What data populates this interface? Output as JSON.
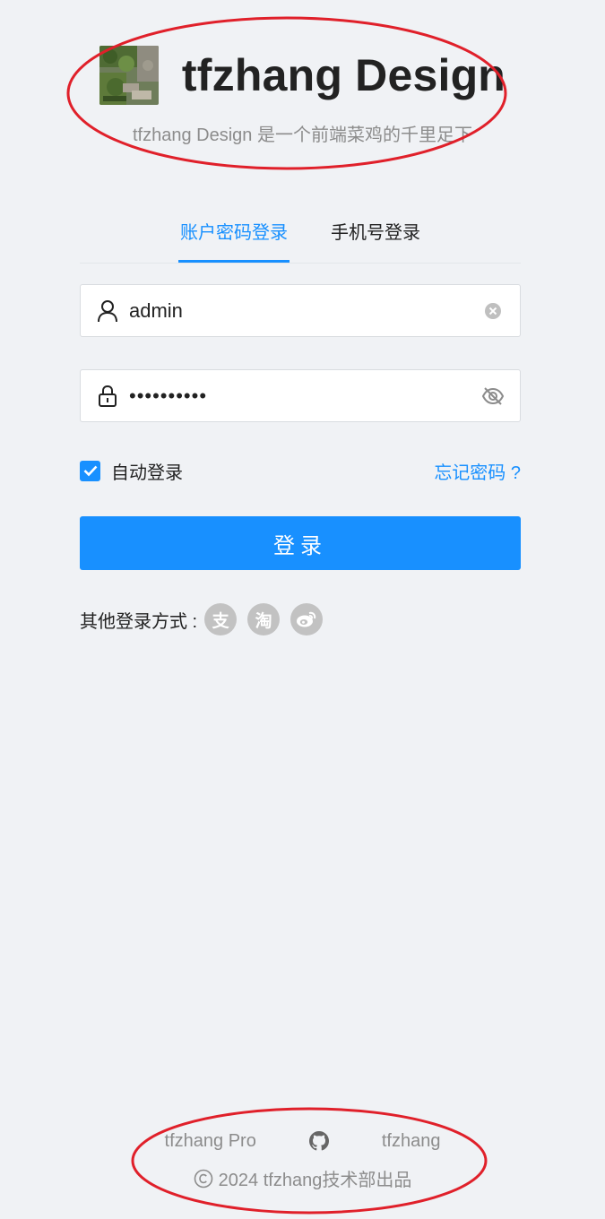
{
  "header": {
    "title": "tfzhang Design",
    "subtitle": "tfzhang Design 是一个前端菜鸡的千里足下"
  },
  "tabs": [
    {
      "label": "账户密码登录",
      "active": true
    },
    {
      "label": "手机号登录",
      "active": false
    }
  ],
  "form": {
    "username": "admin",
    "password_masked": "••••••••••",
    "remember_label": "自动登录",
    "remember_checked": true,
    "forgot_label": "忘记密码 ?",
    "login_label": "登录"
  },
  "other_login": {
    "label": "其他登录方式 :",
    "icons": [
      {
        "name": "alipay-icon",
        "glyph": "支"
      },
      {
        "name": "taobao-icon",
        "glyph": "淘"
      },
      {
        "name": "weibo-icon",
        "glyph": ""
      }
    ]
  },
  "footer": {
    "link_pro": "tfzhang Pro",
    "link_github_icon": "github-icon",
    "link_author": "tfzhang",
    "copyright": "2024 tfzhang技术部出品"
  },
  "colors": {
    "primary": "#1890ff",
    "background": "#f0f2f5",
    "annotation": "#e0202a"
  }
}
